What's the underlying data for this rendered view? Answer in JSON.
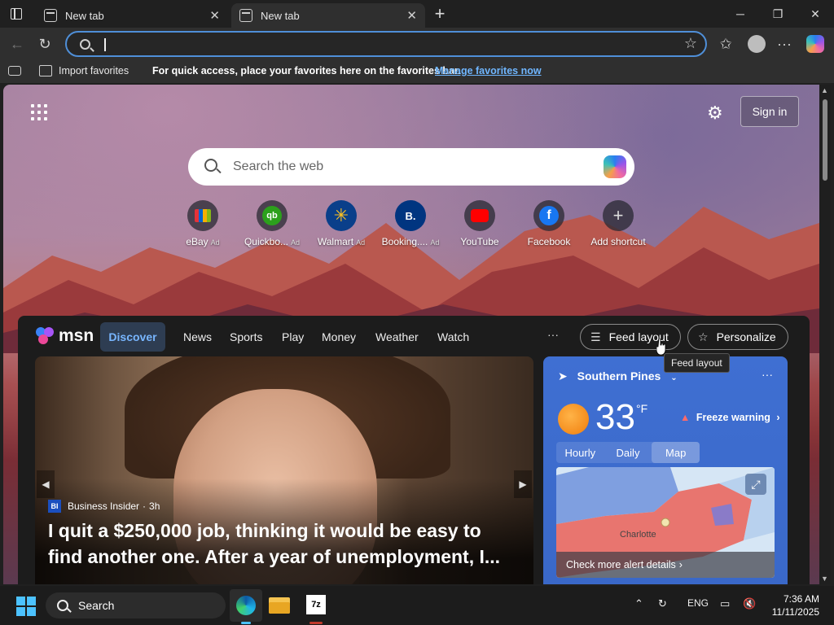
{
  "browser": {
    "tabs": [
      {
        "title": "New tab",
        "active": false
      },
      {
        "title": "New tab",
        "active": true
      }
    ],
    "address_value": "",
    "favorites_bar": {
      "import_label": "Import favorites",
      "hint": "For quick access, place your favorites here on the favorites bar.",
      "manage_link": "Manage favorites now"
    }
  },
  "newtab": {
    "sign_in": "Sign in",
    "search_placeholder": "Search the web",
    "shortcuts": [
      {
        "label": "eBay",
        "ad": "Ad",
        "icon": "ebay-icon",
        "color": "#e53238"
      },
      {
        "label": "Quickbo...",
        "ad": "Ad",
        "icon": "quickbooks-icon",
        "color": "#2ca01c"
      },
      {
        "label": "Walmart",
        "ad": "Ad",
        "icon": "walmart-icon",
        "color": "#0071dc"
      },
      {
        "label": "Booking....",
        "ad": "Ad",
        "icon": "booking-icon",
        "color": "#003580"
      },
      {
        "label": "YouTube",
        "ad": "",
        "icon": "youtube-icon",
        "color": "#ff0000"
      },
      {
        "label": "Facebook",
        "ad": "",
        "icon": "facebook-icon",
        "color": "#1877f2"
      },
      {
        "label": "Add shortcut",
        "ad": "",
        "icon": "plus-icon",
        "color": "#5a5a5a"
      }
    ]
  },
  "feed": {
    "logo_text": "msn",
    "nav": [
      "Discover",
      "News",
      "Sports",
      "Play",
      "Money",
      "Weather",
      "Watch"
    ],
    "more": "···",
    "feed_layout": "Feed layout",
    "personalize": "Personalize",
    "tooltip": "Feed layout",
    "hero": {
      "source": "Business Insider",
      "source_badge": "BI",
      "age": "3h",
      "headline": "I quit a $250,000 job, thinking it would be easy to find another one. After a year of unemployment, I..."
    },
    "weather": {
      "location": "Southern Pines",
      "temp": "33",
      "unit": "°F",
      "alert": "Freeze warning",
      "tabs": [
        "Hourly",
        "Daily",
        "Map"
      ],
      "selected_tab": "Map",
      "map_city": "Charlotte",
      "map_footer": "Check more alert details"
    }
  },
  "taskbar": {
    "search_label": "Search",
    "lang": "ENG",
    "time": "7:36 AM",
    "date": "11/11/2025"
  }
}
